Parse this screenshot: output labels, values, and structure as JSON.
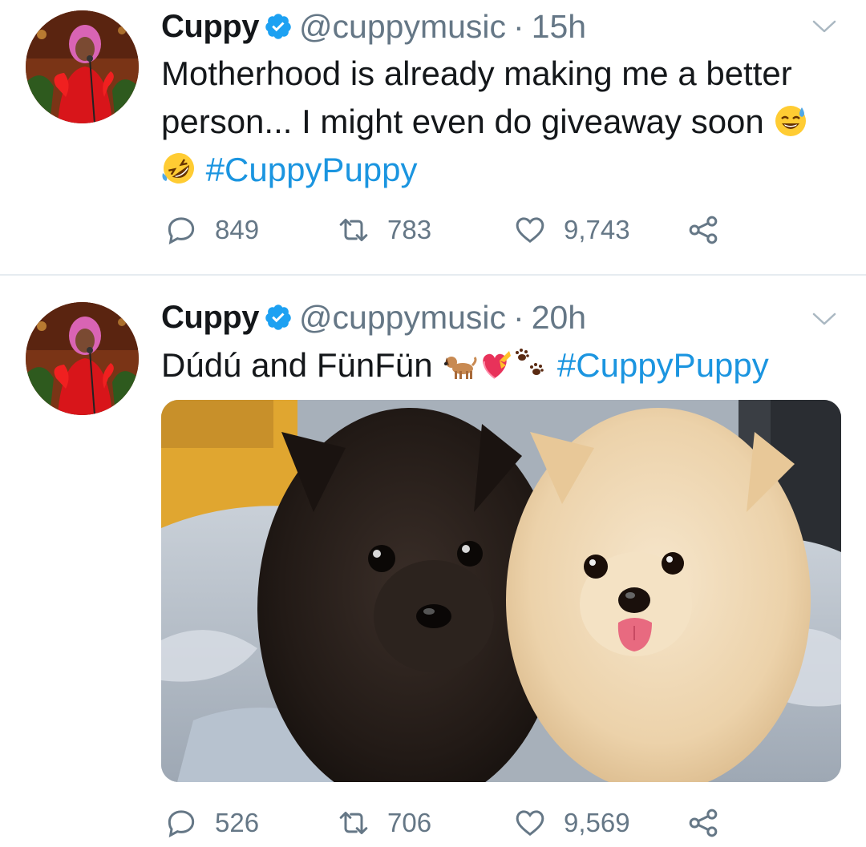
{
  "tweets": [
    {
      "author_name": "Cuppy",
      "handle": "@cuppymusic",
      "separator": "·",
      "time": "15h",
      "text": "Motherhood is already making me a better person... I might even do giveaway soon",
      "emojis": [
        "sweat-smile-emoji",
        "rolling-laughing-emoji"
      ],
      "hashtag": "#CuppyPuppy",
      "replies": "849",
      "retweets": "783",
      "likes": "9,743"
    },
    {
      "author_name": "Cuppy",
      "handle": "@cuppymusic",
      "separator": "·",
      "time": "20h",
      "text": "Dúdú and FünFün",
      "emojis": [
        "dog-emoji",
        "heart-with-ribbon-emoji",
        "paw-prints-emoji"
      ],
      "hashtag": "#CuppyPuppy",
      "media": "photo-two-pomeranian-puppies",
      "replies": "526",
      "retweets": "706",
      "likes": "9,569"
    }
  ],
  "colors": {
    "accent": "#1b95e0",
    "secondary_text": "#657786",
    "divider": "#e6ecf0"
  }
}
